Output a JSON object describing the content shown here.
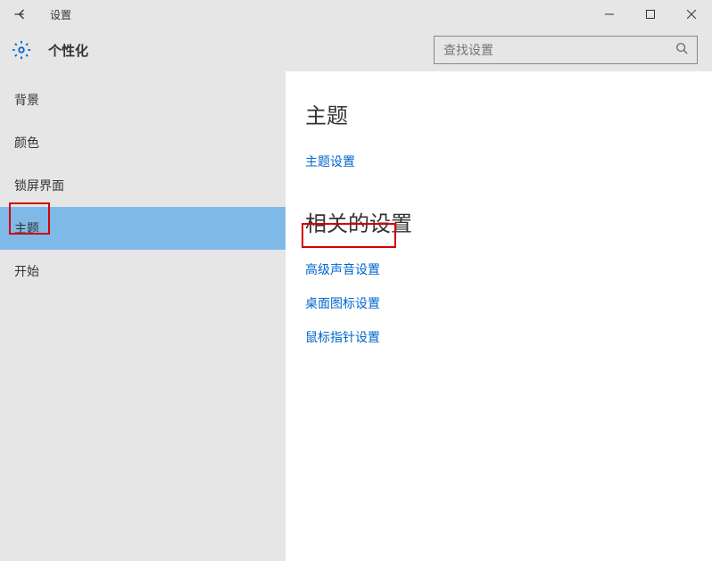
{
  "window": {
    "title": "设置"
  },
  "header": {
    "category": "个性化"
  },
  "search": {
    "placeholder": "查找设置"
  },
  "sidebar": {
    "items": [
      {
        "label": "背景"
      },
      {
        "label": "颜色"
      },
      {
        "label": "锁屏界面"
      },
      {
        "label": "主题"
      },
      {
        "label": "开始"
      }
    ],
    "selectedIndex": 3
  },
  "content": {
    "section1": {
      "title": "主题",
      "link": "主题设置"
    },
    "section2": {
      "title": "相关的设置",
      "links": [
        {
          "label": "高级声音设置"
        },
        {
          "label": "桌面图标设置"
        },
        {
          "label": "鼠标指针设置"
        }
      ]
    }
  }
}
